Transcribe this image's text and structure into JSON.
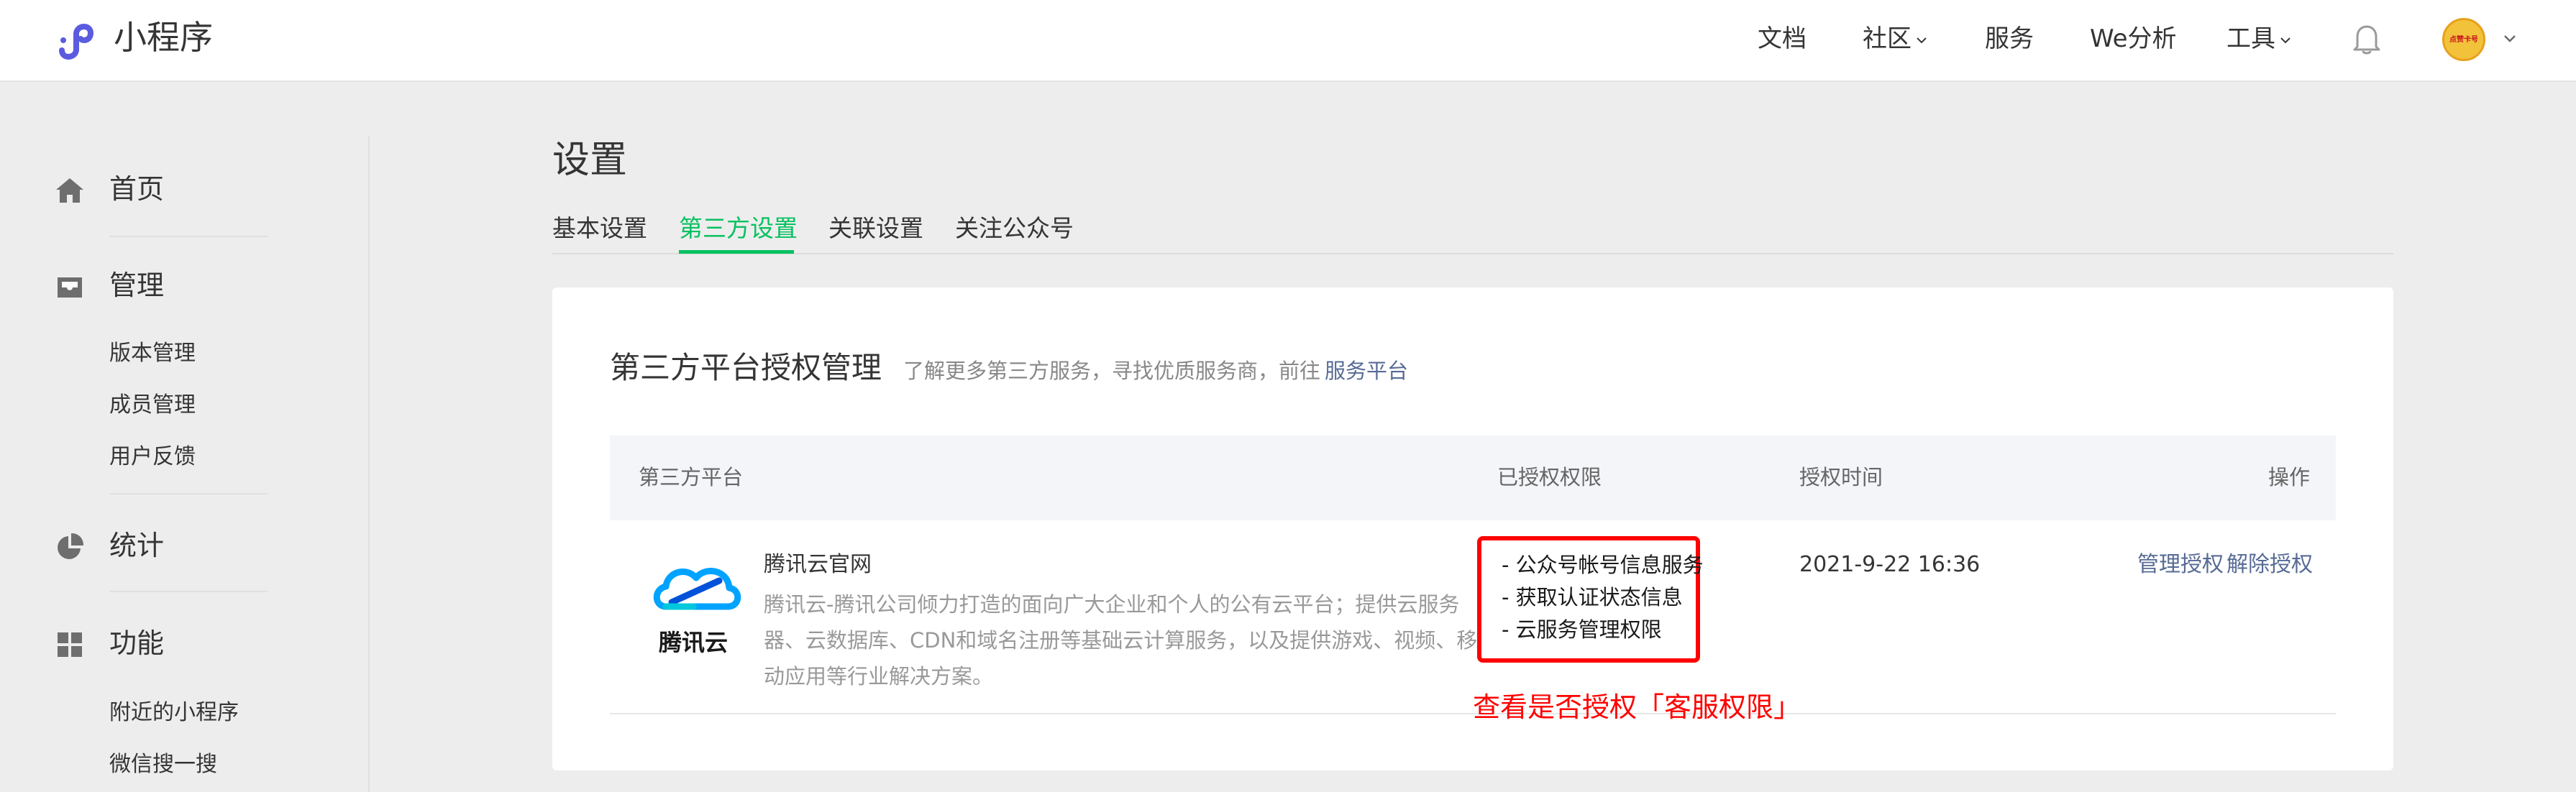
{
  "brand": {
    "name": "小程序"
  },
  "topnav": {
    "items": [
      {
        "label": "文档"
      },
      {
        "label": "社区"
      },
      {
        "label": "服务"
      },
      {
        "label": "We分析"
      },
      {
        "label": "工具"
      }
    ],
    "avatar_text": "点赞卡号"
  },
  "sidebar": {
    "groups": [
      {
        "label": "首页",
        "icon": "home-icon"
      },
      {
        "label": "管理",
        "icon": "inbox-icon",
        "items": [
          "版本管理",
          "成员管理",
          "用户反馈"
        ]
      },
      {
        "label": "统计",
        "icon": "pie-chart-icon"
      },
      {
        "label": "功能",
        "icon": "grid-icon",
        "items": [
          "附近的小程序",
          "微信搜一搜"
        ]
      }
    ]
  },
  "page": {
    "title": "设置",
    "tabs": [
      "基本设置",
      "第三方设置",
      "关联设置",
      "关注公众号"
    ],
    "active_tab": "第三方设置"
  },
  "section": {
    "title": "第三方平台授权管理",
    "desc": "了解更多第三方服务，寻找优质服务商，前往",
    "link": "服务平台"
  },
  "table": {
    "headers": [
      "第三方平台",
      "已授权权限",
      "授权时间",
      "操作"
    ],
    "rows": [
      {
        "logo_text": "腾讯云",
        "name": "腾讯云官网",
        "desc": "腾讯云-腾讯公司倾力打造的面向广大企业和个人的公有云平台；提供云服务器、云数据库、CDN和域名注册等基础云计算服务，以及提供游戏、视频、移动应用等行业解决方案。",
        "permissions": [
          "- 公众号帐号信息服务",
          "- 获取认证状态信息",
          "- 云服务管理权限"
        ],
        "time": "2021-9-22 16:36",
        "actions": [
          "管理授权",
          "解除授权"
        ]
      }
    ]
  },
  "annotation": "查看是否授权「客服权限」",
  "colors": {
    "accent_green": "#07c160",
    "link_blue": "#576b95",
    "annotation_red": "#ff0000"
  }
}
